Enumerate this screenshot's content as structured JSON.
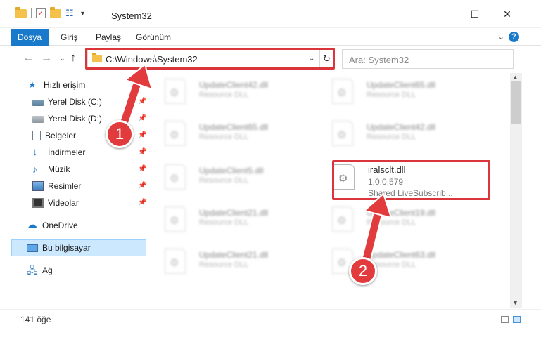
{
  "window": {
    "title": "System32",
    "minimize": "—",
    "maximize": "☐",
    "close": "✕"
  },
  "ribbon": {
    "file_tab": "Dosya",
    "tabs": [
      "Giriş",
      "Paylaş",
      "Görünüm"
    ],
    "expand": "⌄",
    "help": "?"
  },
  "navigation": {
    "back": "←",
    "forward": "→",
    "recent": "⌄",
    "up": "↑",
    "address": "C:\\Windows\\System32",
    "address_dropdown": "⌄",
    "refresh": "↻",
    "search_placeholder": "Ara: System32"
  },
  "sidebar": {
    "quick_access": "Hızlı erişim",
    "items": [
      {
        "label": "Yerel Disk (C:)",
        "icon": "drive-icon"
      },
      {
        "label": "Yerel Disk (D:)",
        "icon": "drive-icon"
      },
      {
        "label": "Belgeler",
        "icon": "documents-icon"
      },
      {
        "label": "İndirmeler",
        "icon": "downloads-icon"
      },
      {
        "label": "Müzik",
        "icon": "music-icon"
      },
      {
        "label": "Resimler",
        "icon": "pictures-icon"
      },
      {
        "label": "Videolar",
        "icon": "videos-icon"
      }
    ],
    "onedrive": "OneDrive",
    "this_pc": "Bu bilgisayar",
    "network": "Ağ",
    "pin_glyph": "📌"
  },
  "files": {
    "left_column": [
      {
        "name": "UpdateClient42.dll",
        "desc": "Resource DLL"
      },
      {
        "name": "UpdateClient65.dll",
        "desc": "Resource DLL"
      },
      {
        "name": "UpdateClient5.dll",
        "desc": "Resource DLL"
      },
      {
        "name": "UpdateClient21.dll",
        "desc": "Resource DLL"
      },
      {
        "name": "UpdateClient21.dll",
        "desc": "Resource DLL"
      }
    ],
    "right_column": [
      {
        "name": "UpdateClient65.dll",
        "desc": "Resource DLL"
      },
      {
        "name": "UpdateClient42.dll",
        "desc": "Resource DLL"
      },
      {
        "name": "UpdateClient19.dll",
        "desc": "Resource DLL"
      },
      {
        "name": "UpdateClient63.dll",
        "desc": "Resource DLL"
      }
    ],
    "highlighted": {
      "name": "iralsclt.dll",
      "version": "1.0.0.579",
      "desc": "Shared LiveSubscrib..."
    }
  },
  "status": {
    "count": "141 öğe"
  },
  "annotations": {
    "step1": "1",
    "step2": "2",
    "color": "#e23b3e"
  }
}
